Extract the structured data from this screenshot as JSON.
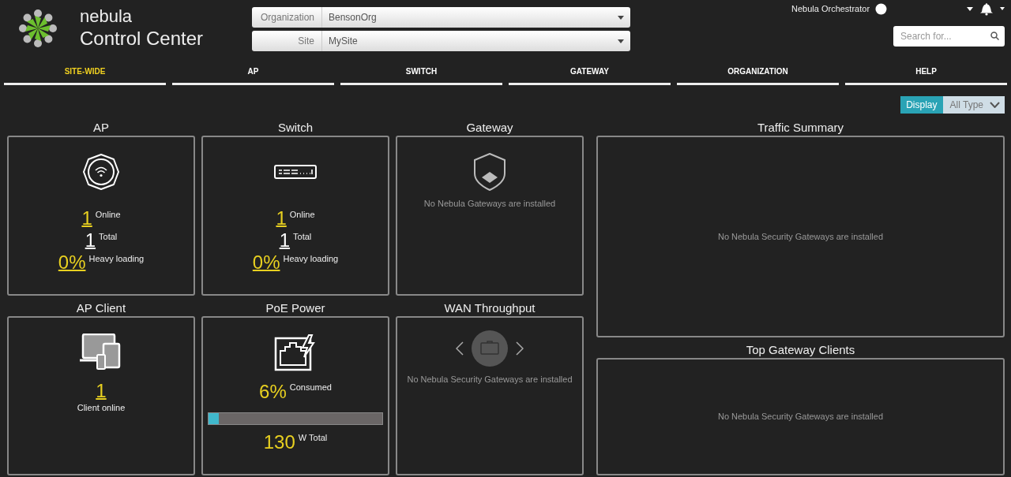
{
  "brand": {
    "line1": "nebula",
    "line2": "Control Center"
  },
  "selectors": [
    {
      "label": "Organization",
      "value": "BensonOrg"
    },
    {
      "label": "Site",
      "value": "MySite"
    }
  ],
  "account": {
    "name": "Nebula Orchestrator"
  },
  "search": {
    "placeholder": "Search for..."
  },
  "tabs": [
    {
      "label": "SITE-WIDE",
      "selected": true
    },
    {
      "label": "AP",
      "selected": false
    },
    {
      "label": "SWITCH",
      "selected": false
    },
    {
      "label": "GATEWAY",
      "selected": false
    },
    {
      "label": "ORGANIZATION",
      "selected": false
    },
    {
      "label": "HELP",
      "selected": false
    }
  ],
  "filter": {
    "button": "Display",
    "value": "All Type"
  },
  "panels": [
    {
      "kind": "ap",
      "title": "AP",
      "stats": [
        {
          "value": "1",
          "label": "Online",
          "highlighted": true
        },
        {
          "value": "1",
          "label": "Total",
          "highlighted": false
        },
        {
          "value": "0%",
          "label": "Heavy loading",
          "highlighted": true
        }
      ]
    },
    {
      "kind": "switch",
      "title": "Switch",
      "stats": [
        {
          "value": "1",
          "label": "Online",
          "highlighted": true
        },
        {
          "value": "1",
          "label": "Total",
          "highlighted": false
        },
        {
          "value": "0%",
          "label": "Heavy loading",
          "highlighted": true
        }
      ]
    },
    {
      "kind": "gateway",
      "title": "Gateway",
      "message": "No Nebula Gateways are installed"
    },
    {
      "kind": "clients",
      "title": "AP Client",
      "value": "1",
      "label": "Client online"
    },
    {
      "kind": "poe",
      "title": "PoE Power",
      "percent": "6%",
      "percent_label": "Consumed",
      "level": 0.06,
      "total": "130",
      "total_label": "W Total"
    },
    {
      "kind": "wan",
      "title": "WAN Throughput",
      "message": "No Nebula Security Gateways are installed"
    }
  ],
  "side_panels": [
    {
      "title": "Traffic Summary",
      "message": "No Nebula Security Gateways are installed"
    },
    {
      "title": "Top Gateway Clients",
      "message": "No Nebula Security Gateways are installed"
    }
  ]
}
